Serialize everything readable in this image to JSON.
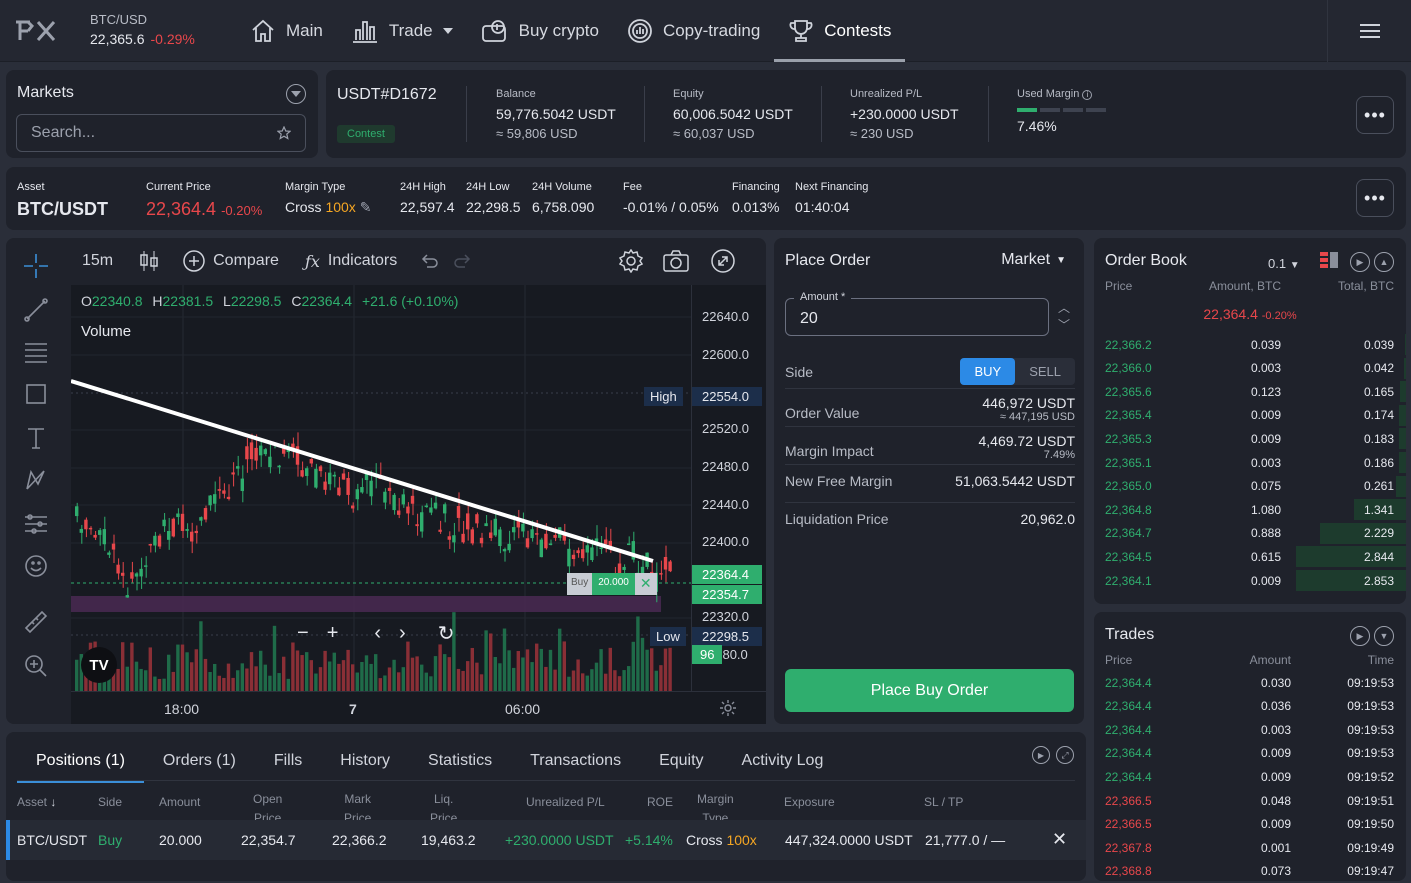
{
  "ticker": {
    "pair": "BTC/USD",
    "price": "22,365.6",
    "change": "-0.29%"
  },
  "nav": [
    {
      "label": "Main",
      "icon": "home-icon"
    },
    {
      "label": "Trade",
      "icon": "bar-chart-icon"
    },
    {
      "label": "Buy crypto",
      "icon": "wallet-icon"
    },
    {
      "label": "Copy-trading",
      "icon": "copy-trading-icon"
    },
    {
      "label": "Contests",
      "icon": "trophy-icon"
    }
  ],
  "markets": {
    "title": "Markets",
    "search_placeholder": "Search..."
  },
  "account": {
    "id": "USDT#D1672",
    "badge": "Contest",
    "balance": {
      "label": "Balance",
      "value": "59,776.5042 USDT",
      "sub": "≈ 59,806 USD"
    },
    "equity": {
      "label": "Equity",
      "value": "60,006.5042 USDT",
      "sub": "≈ 60,037 USD"
    },
    "upl": {
      "label": "Unrealized P/L",
      "value": "+230.0000 USDT",
      "sub": "≈ 230 USD"
    },
    "margin": {
      "label": "Used Margin",
      "value": "7.46%"
    }
  },
  "asset": {
    "asset_label": "Asset",
    "asset": "BTC/USDT",
    "price_label": "Current Price",
    "price": "22,364.4",
    "price_change": "-0.20%",
    "margin_label": "Margin Type",
    "margin_type": "Cross",
    "leverage": "100x",
    "high_label": "24H High",
    "high": "22,597.4",
    "low_label": "24H Low",
    "low": "22,298.5",
    "vol_label": "24H Volume",
    "vol": "6,758.090",
    "fee_label": "Fee",
    "fee": "-0.01% / 0.05%",
    "fin_label": "Financing",
    "fin": "0.013%",
    "next_label": "Next Financing",
    "next": "01:40:04"
  },
  "chart_toolbar": {
    "interval": "15m",
    "compare": "Compare",
    "indicators": "Indicators"
  },
  "chart": {
    "ohlc": {
      "o": "22340.8",
      "h": "22381.5",
      "l": "22298.5",
      "c": "22364.4",
      "chg": "+21.6 (+0.10%)"
    },
    "volume_label": "Volume",
    "price_ticks": [
      "22640.0",
      "22600.0",
      "22520.0",
      "22480.0",
      "22440.0",
      "22400.0",
      "22320.0"
    ],
    "high_tag": "High",
    "high_value": "22554.0",
    "cur_value": "22364.4",
    "buy_value": "22354.7",
    "low_tag": "Low",
    "low_value": "22298.5",
    "countdown": "96",
    "countdown_suffix": "80.0",
    "time_ticks": [
      "18:00",
      "7",
      "06:00"
    ],
    "buy_tag": "Buy",
    "buy_amount": "20.000"
  },
  "order": {
    "title": "Place Order",
    "type": "Market",
    "amount_label": "Amount *",
    "amount": "20",
    "side_label": "Side",
    "buy": "BUY",
    "sell": "SELL",
    "ov_label": "Order Value",
    "ov": "446,972 USDT",
    "ov_sub": "≈ 447,195 USD",
    "mi_label": "Margin Impact",
    "mi": "4,469.72 USDT",
    "mi_sub": "7.49%",
    "nfm_label": "New Free Margin",
    "nfm": "51,063.5442 USDT",
    "liq_label": "Liquidation Price",
    "liq": "20,962.0",
    "submit": "Place Buy Order"
  },
  "book": {
    "title": "Order Book",
    "step": "0.1",
    "headers": [
      "Price",
      "Amount, BTC",
      "Total, BTC"
    ],
    "mid": "22,364.4",
    "mid_change": "-0.20%",
    "rows": [
      {
        "p": "22,366.2",
        "a": "0.039",
        "t": "0.039"
      },
      {
        "p": "22,366.0",
        "a": "0.003",
        "t": "0.042"
      },
      {
        "p": "22,365.6",
        "a": "0.123",
        "t": "0.165"
      },
      {
        "p": "22,365.4",
        "a": "0.009",
        "t": "0.174"
      },
      {
        "p": "22,365.3",
        "a": "0.009",
        "t": "0.183"
      },
      {
        "p": "22,365.1",
        "a": "0.003",
        "t": "0.186"
      },
      {
        "p": "22,365.0",
        "a": "0.075",
        "t": "0.261"
      },
      {
        "p": "22,364.8",
        "a": "1.080",
        "t": "1.341"
      },
      {
        "p": "22,364.7",
        "a": "0.888",
        "t": "2.229"
      },
      {
        "p": "22,364.5",
        "a": "0.615",
        "t": "2.844"
      },
      {
        "p": "22,364.1",
        "a": "0.009",
        "t": "2.853"
      }
    ]
  },
  "trades": {
    "title": "Trades",
    "headers": [
      "Price",
      "Amount",
      "Time"
    ],
    "rows": [
      {
        "p": "22,364.4",
        "a": "0.030",
        "t": "09:19:53",
        "side": "buy"
      },
      {
        "p": "22,364.4",
        "a": "0.036",
        "t": "09:19:53",
        "side": "buy"
      },
      {
        "p": "22,364.4",
        "a": "0.003",
        "t": "09:19:53",
        "side": "buy"
      },
      {
        "p": "22,364.4",
        "a": "0.009",
        "t": "09:19:53",
        "side": "buy"
      },
      {
        "p": "22,364.4",
        "a": "0.009",
        "t": "09:19:52",
        "side": "buy"
      },
      {
        "p": "22,366.5",
        "a": "0.048",
        "t": "09:19:51",
        "side": "sell"
      },
      {
        "p": "22,366.5",
        "a": "0.009",
        "t": "09:19:50",
        "side": "sell"
      },
      {
        "p": "22,367.8",
        "a": "0.001",
        "t": "09:19:49",
        "side": "sell"
      },
      {
        "p": "22,368.8",
        "a": "0.073",
        "t": "09:19:47",
        "side": "sell"
      }
    ]
  },
  "positions": {
    "tabs": [
      "Positions (1)",
      "Orders (1)",
      "Fills",
      "History",
      "Statistics",
      "Transactions",
      "Equity",
      "Activity Log"
    ],
    "headers": {
      "asset": "Asset",
      "side": "Side",
      "amount": "Amount",
      "open1": "Open",
      "open2": "Price",
      "mark1": "Mark",
      "mark2": "Price",
      "liq1": "Liq.",
      "liq2": "Price",
      "upl": "Unrealized P/L",
      "roe": "ROE",
      "mt1": "Margin",
      "mt2": "Type",
      "exp": "Exposure",
      "sltp": "SL / TP"
    },
    "row": {
      "asset": "BTC/USDT",
      "side": "Buy",
      "amount": "20.000",
      "open": "22,354.7",
      "mark": "22,366.2",
      "liq": "19,463.2",
      "upl": "+230.0000 USDT",
      "roe": "+5.14%",
      "mt": "Cross",
      "lev": "100x",
      "exp": "447,324.0000 USDT",
      "sltp": "21,777.0 / —"
    }
  },
  "colors": {
    "green": "#2fae6e",
    "red": "#e8474b",
    "blue": "#2c8ae6",
    "orange": "#f5a623"
  }
}
